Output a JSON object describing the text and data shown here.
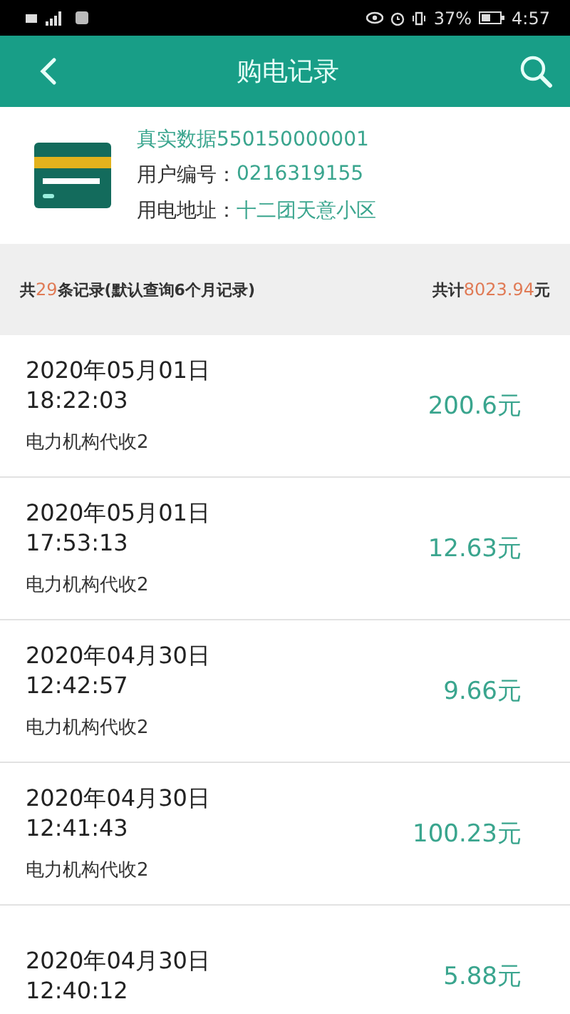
{
  "status_bar": {
    "time": "4:57",
    "battery": "37%"
  },
  "header": {
    "title": "购电记录"
  },
  "account": {
    "name": "真实数据550150000001",
    "fields": [
      {
        "label": "用户编号：",
        "value": "0216319155"
      },
      {
        "label": "用电地址：",
        "value": "十二团天意小区"
      }
    ]
  },
  "summary": {
    "left_prefix": "共",
    "count": "29",
    "left_suffix": "条记录(默认查询6个月记录)",
    "right_prefix": "共计",
    "total": "8023.94",
    "unit": "元"
  },
  "records": [
    {
      "date": "2020年05月01日",
      "time": "18:22:03",
      "source": "电力机构代收2",
      "amount": "200.6元"
    },
    {
      "date": "2020年05月01日",
      "time": "17:53:13",
      "source": "电力机构代收2",
      "amount": "12.63元"
    },
    {
      "date": "2020年04月30日",
      "time": "12:42:57",
      "source": "电力机构代收2",
      "amount": "9.66元"
    },
    {
      "date": "2020年04月30日",
      "time": "12:41:43",
      "source": "电力机构代收2",
      "amount": "100.23元"
    },
    {
      "date": "2020年04月30日",
      "time": "12:40:12",
      "amount": "5.88元"
    }
  ]
}
